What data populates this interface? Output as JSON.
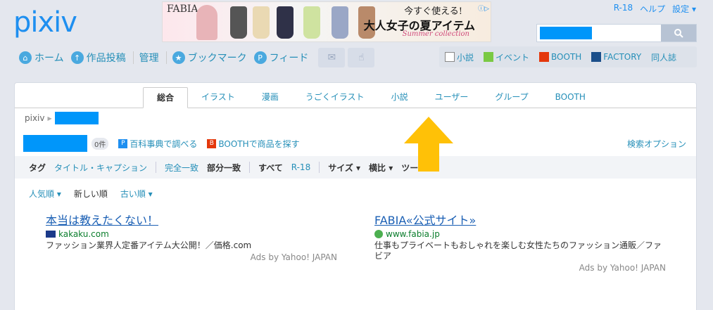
{
  "logo": "pixiv",
  "banner": {
    "brand": "FABIA",
    "line1": "今すぐ使える!",
    "line2": "大人女子の夏アイテム",
    "line3": "Summer collection",
    "adchoice": "ⓘ▷"
  },
  "top_links": [
    "R-18",
    "ヘルプ",
    "設定 ▾"
  ],
  "search": {
    "placeholder": ""
  },
  "main_nav": [
    "ホーム",
    "作品投稿",
    "管理",
    "ブックマーク",
    "フィード"
  ],
  "service_bar": [
    "小説",
    "イベント",
    "BOOTH",
    "FACTORY",
    "同人誌"
  ],
  "tabs": [
    "総合",
    "イラスト",
    "漫画",
    "うごくイラスト",
    "小説",
    "ユーザー",
    "グループ",
    "BOOTH"
  ],
  "breadcrumb": {
    "root": "pixiv"
  },
  "query": {
    "count": "0件",
    "encyclopedia": "百科事典で調べる",
    "booth": "BOOTHで商品を探す",
    "options": "検索オプション"
  },
  "filters": [
    "タグ",
    "タイトル・キャプション",
    "完全一致",
    "部分一致",
    "すべて",
    "R-18",
    "サイズ ▾",
    "横比 ▾",
    "ツール ▾"
  ],
  "sort": [
    "人気順 ▾",
    "新しい順",
    "古い順 ▾"
  ],
  "ads": [
    {
      "title": "本当は教えたくない！",
      "url": "kakaku.com",
      "desc": "ファッション業界人定番アイテム大公開！／価格.com",
      "by": "Ads by Yahoo! JAPAN"
    },
    {
      "title": "FABIA«公式サイト»",
      "url": "www.fabia.jp",
      "desc": "仕事もプライベートもおしゃれを楽しむ女性たちのファッション通販／ファビア",
      "by": "Ads by Yahoo! JAPAN"
    }
  ],
  "colors": {
    "accent": "#0096fa",
    "link": "#258fb8",
    "arrow": "#ffc107"
  }
}
